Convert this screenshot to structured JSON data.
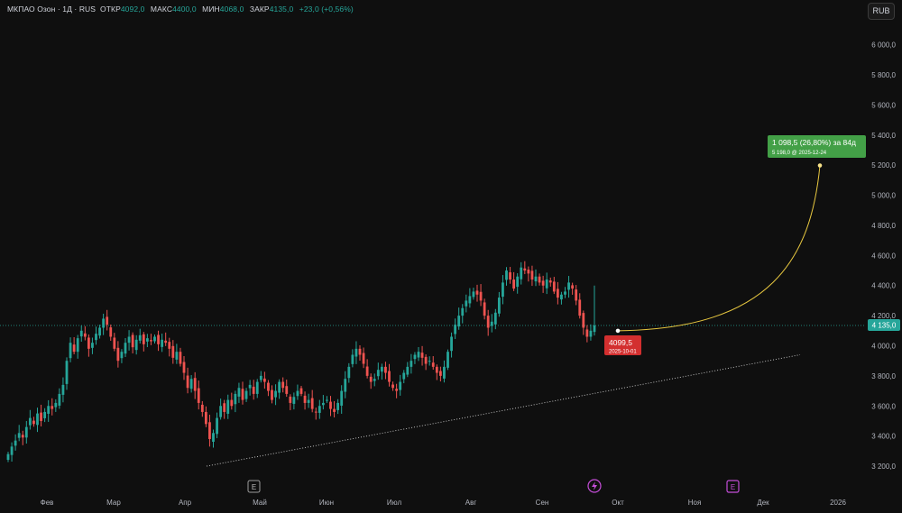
{
  "header": {
    "instrument": "МКПАО Озон · 1Д · RUS",
    "open_label": "ОТКР",
    "open_value": "4092,0",
    "high_label": "МАКС",
    "high_value": "4400,0",
    "low_label": "МИН",
    "low_value": "4068,0",
    "close_label": "ЗАКР",
    "close_value": "4135,0",
    "change": "+23,0 (+0,56%)"
  },
  "currency_button": "RUB",
  "colors": {
    "up": "#26a69a",
    "down": "#ef5350",
    "background": "#0f0f0f",
    "projection": "#f0c419",
    "target_label": "#43a047",
    "low_label": "#d32f2f"
  },
  "chart_data": {
    "type": "candlestick",
    "y_axis": {
      "min": 3100,
      "max": 6100,
      "ticks": [
        "3 200,0",
        "3 400,0",
        "3 600,0",
        "3 800,0",
        "4 000,0",
        "4 200,0",
        "4 400,0",
        "4 600,0",
        "4 800,0",
        "5 000,0",
        "5 200,0",
        "5 400,0",
        "5 600,0",
        "5 800,0",
        "6 000,0"
      ]
    },
    "x_axis": {
      "labels": [
        "Фев",
        "Мар",
        "Апр",
        "Май",
        "Июн",
        "Июл",
        "Авг",
        "Сен",
        "Окт",
        "Ноя",
        "Дек",
        "2026"
      ]
    },
    "last_price_label": "4 135,0",
    "last_price": 4135,
    "trend_line": {
      "from": {
        "date": "2025-04-08",
        "value": 3200
      },
      "to": {
        "date": "2025-12-18",
        "value": 3940
      }
    },
    "closes": [
      3280,
      3330,
      3370,
      3420,
      3390,
      3460,
      3520,
      3480,
      3550,
      3500,
      3560,
      3600,
      3580,
      3620,
      3680,
      3740,
      3900,
      4020,
      3960,
      4050,
      4100,
      4060,
      3980,
      4020,
      4080,
      4120,
      4180,
      4140,
      4060,
      3980,
      3900,
      3960,
      4020,
      4060,
      3990,
      4040,
      4070,
      4010,
      4050,
      4030,
      4060,
      4010,
      4040,
      4020,
      3980,
      3920,
      3960,
      3880,
      3820,
      3720,
      3780,
      3700,
      3620,
      3560,
      3480,
      3380,
      3420,
      3520,
      3600,
      3560,
      3640,
      3600,
      3680,
      3720,
      3640,
      3700,
      3740,
      3680,
      3760,
      3800,
      3760,
      3700,
      3640,
      3700,
      3760,
      3720,
      3680,
      3620,
      3660,
      3700,
      3680,
      3620,
      3640,
      3580,
      3560,
      3600,
      3620,
      3640,
      3580,
      3560,
      3620,
      3700,
      3780,
      3860,
      3940,
      3980,
      3940,
      3880,
      3800,
      3760,
      3780,
      3840,
      3860,
      3820,
      3760,
      3720,
      3700,
      3760,
      3820,
      3860,
      3900,
      3940,
      3960,
      3920,
      3880,
      3900,
      3860,
      3820,
      3800,
      3860,
      3960,
      4060,
      4140,
      4200,
      4250,
      4300,
      4330,
      4360,
      4340,
      4300,
      4200,
      4120,
      4160,
      4220,
      4320,
      4420,
      4500,
      4440,
      4380,
      4460,
      4520,
      4500,
      4480,
      4440,
      4460,
      4420,
      4400,
      4440,
      4420,
      4360,
      4320,
      4340,
      4360,
      4420,
      4380,
      4300,
      4200,
      4120,
      4060,
      4100,
      4135
    ],
    "projection": {
      "start_label": "4099,5",
      "start_date": "2025-10-01",
      "start_value": 4099.5,
      "target_main": "1 098,5 (26,80%) за 84д",
      "target_sub": "5 198,0 @ 2025-12-24",
      "target_value": 5198
    },
    "event_icons": [
      "E",
      "E"
    ]
  }
}
